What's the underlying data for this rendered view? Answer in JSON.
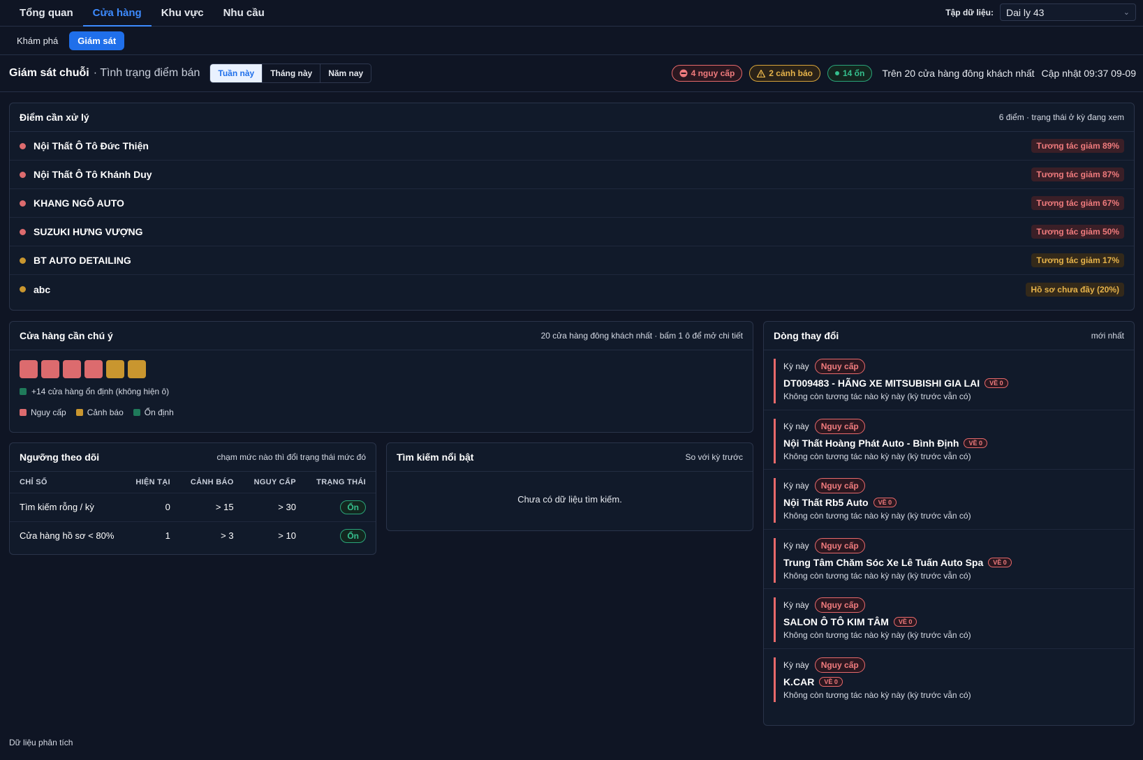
{
  "nav": {
    "tabs": [
      "Tổng quan",
      "Cửa hàng",
      "Khu vực",
      "Nhu cầu"
    ],
    "dataset_label": "Tập dữ liệu:",
    "dataset_value": "Dai ly 43"
  },
  "subnav": {
    "tabs": [
      "Khám phá",
      "Giám sát"
    ]
  },
  "header": {
    "title": "Giám sát chuỗi",
    "subtitle": "· Tình trạng điểm bán",
    "periods": [
      "Tuần này",
      "Tháng này",
      "Năm nay"
    ],
    "crit_pill": "4 nguy cấp",
    "warn_pill": "2 cảnh báo",
    "ok_pill": "14 ổn",
    "scope_note": "Trên 20 cửa hàng đông khách nhất",
    "updated": "Cập nhật 09:37 09-09"
  },
  "issues": {
    "title": "Điểm cần xử lý",
    "meta": "6 điểm · trạng thái ở kỳ đang xem",
    "items": [
      {
        "name": "Nội Thất Ô Tô Đức Thiện",
        "tag": "Tương tác giảm 89%",
        "level": "crit"
      },
      {
        "name": "Nội Thất Ô Tô Khánh Duy",
        "tag": "Tương tác giảm 87%",
        "level": "crit"
      },
      {
        "name": "KHANG NGÔ AUTO",
        "tag": "Tương tác giảm 67%",
        "level": "crit"
      },
      {
        "name": "SUZUKI HƯNG VƯỢNG",
        "tag": "Tương tác giảm 50%",
        "level": "crit"
      },
      {
        "name": "BT AUTO DETAILING",
        "tag": "Tương tác giảm 17%",
        "level": "warn"
      },
      {
        "name": "abc",
        "tag": "Hồ sơ chưa đầy (20%)",
        "level": "warn"
      }
    ]
  },
  "attention": {
    "title": "Cửa hàng cần chú ý",
    "meta": "20 cửa hàng đông khách nhất · bấm 1 ô để mở chi tiết",
    "squares": [
      "crit",
      "crit",
      "crit",
      "crit",
      "warn",
      "warn"
    ],
    "stable_note": "+14 cửa hàng ổn định (không hiện ô)",
    "legend": [
      "Nguy cấp",
      "Cảnh báo",
      "Ổn định"
    ]
  },
  "thresholds": {
    "title": "Ngưỡng theo dõi",
    "meta": "chạm mức nào thì đổi trạng thái mức đó",
    "columns": [
      "CHỈ SỐ",
      "HIỆN TẠI",
      "CẢNH BÁO",
      "NGUY CẤP",
      "TRẠNG THÁI"
    ],
    "rows": [
      {
        "metric": "Tìm kiếm rỗng / kỳ",
        "current": "0",
        "warn": "> 15",
        "crit": "> 30",
        "status": "Ổn"
      },
      {
        "metric": "Cửa hàng hồ sơ < 80%",
        "current": "1",
        "warn": "> 3",
        "crit": "> 10",
        "status": "Ổn"
      }
    ]
  },
  "search": {
    "title": "Tìm kiếm nổi bật",
    "meta": "So với kỳ trước",
    "empty": "Chưa có dữ liệu tìm kiếm."
  },
  "changes": {
    "title": "Dòng thay đổi",
    "meta": "mới nhất",
    "items": [
      {
        "period": "Kỳ này",
        "badge": "Nguy cấp",
        "name": "DT009483 - HÃNG XE MITSUBISHI GIA LAI",
        "ve": "VỀ 0",
        "desc": "Không còn tương tác nào kỳ này (kỳ trước vẫn có)"
      },
      {
        "period": "Kỳ này",
        "badge": "Nguy cấp",
        "name": "Nội Thất Hoàng Phát Auto - Bình Định",
        "ve": "VỀ 0",
        "desc": "Không còn tương tác nào kỳ này (kỳ trước vẫn có)"
      },
      {
        "period": "Kỳ này",
        "badge": "Nguy cấp",
        "name": "Nội Thất Rb5 Auto",
        "ve": "VỀ 0",
        "desc": "Không còn tương tác nào kỳ này (kỳ trước vẫn có)"
      },
      {
        "period": "Kỳ này",
        "badge": "Nguy cấp",
        "name": "Trung Tâm Chăm Sóc Xe Lê Tuấn Auto Spa",
        "ve": "VỀ 0",
        "desc": "Không còn tương tác nào kỳ này (kỳ trước vẫn có)"
      },
      {
        "period": "Kỳ này",
        "badge": "Nguy cấp",
        "name": "SALON Ô TÔ KIM TÂM",
        "ve": "VỀ 0",
        "desc": "Không còn tương tác nào kỳ này (kỳ trước vẫn có)"
      },
      {
        "period": "Kỳ này",
        "badge": "Nguy cấp",
        "name": "K.CAR",
        "ve": "VỀ 0",
        "desc": "Không còn tương tác nào kỳ này (kỳ trước vẫn có)"
      }
    ]
  },
  "footer": {
    "text": "Dữ liệu phân tích"
  },
  "colors": {
    "crit": "#dc6b6e",
    "warn": "#c9962f",
    "ok": "#1f7a5a",
    "accent": "#1f6fea"
  }
}
